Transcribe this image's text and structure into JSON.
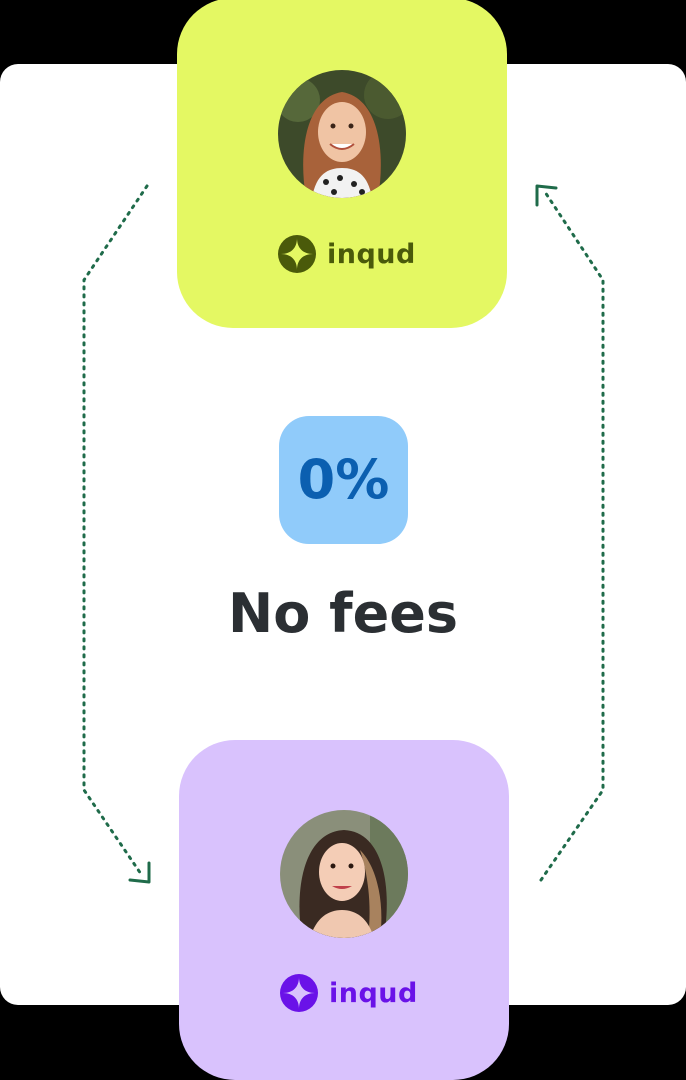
{
  "cards": {
    "top": {
      "brand_name": "inqud",
      "background": "#e4f863",
      "brand_color": "#4a5a0a",
      "avatar_description": "sender-avatar"
    },
    "bottom": {
      "brand_name": "inqud",
      "background": "#d9c2fd",
      "brand_color": "#6a12e8",
      "avatar_description": "recipient-avatar"
    }
  },
  "fee": {
    "value": "0%",
    "label": "No fees",
    "badge_color": "#90cbfa",
    "value_color": "#0b5fb0",
    "label_color": "#2b2f33"
  },
  "flow_arrows": {
    "color": "#1f6b4a",
    "icons": [
      "arrow-down-left-icon",
      "arrow-up-right-icon"
    ]
  }
}
